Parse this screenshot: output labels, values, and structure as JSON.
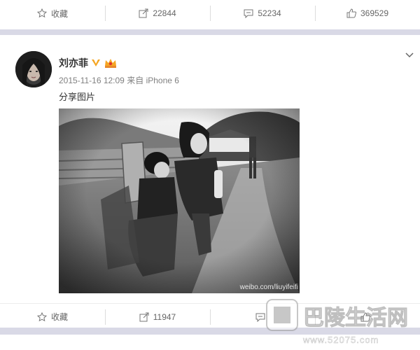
{
  "top_post": {
    "actions": [
      {
        "icon": "star-icon",
        "label": "收藏"
      },
      {
        "icon": "share-icon",
        "label": "22844"
      },
      {
        "icon": "comment-icon",
        "label": "52234"
      },
      {
        "icon": "like-icon",
        "label": "369529"
      }
    ]
  },
  "post": {
    "username": "刘亦菲",
    "verified_badge": "V",
    "timestamp": "2015-11-16 12:09",
    "source_prefix": "来自",
    "source": "iPhone 6",
    "text": "分享图片",
    "image_watermark": "weibo.com/liuyifeifi",
    "actions": [
      {
        "icon": "star-icon",
        "label": "收藏"
      },
      {
        "icon": "share-icon",
        "label": "11947"
      },
      {
        "icon": "comment-icon",
        "label": ""
      },
      {
        "icon": "like-icon",
        "label": ""
      }
    ]
  },
  "site_watermark": {
    "title": "巴陵生活网",
    "url": "www.52075.com"
  },
  "colors": {
    "page_bg": "#d9d9e6",
    "card_bg": "#ffffff",
    "verified": "#f5a623",
    "action_text": "#666666"
  }
}
